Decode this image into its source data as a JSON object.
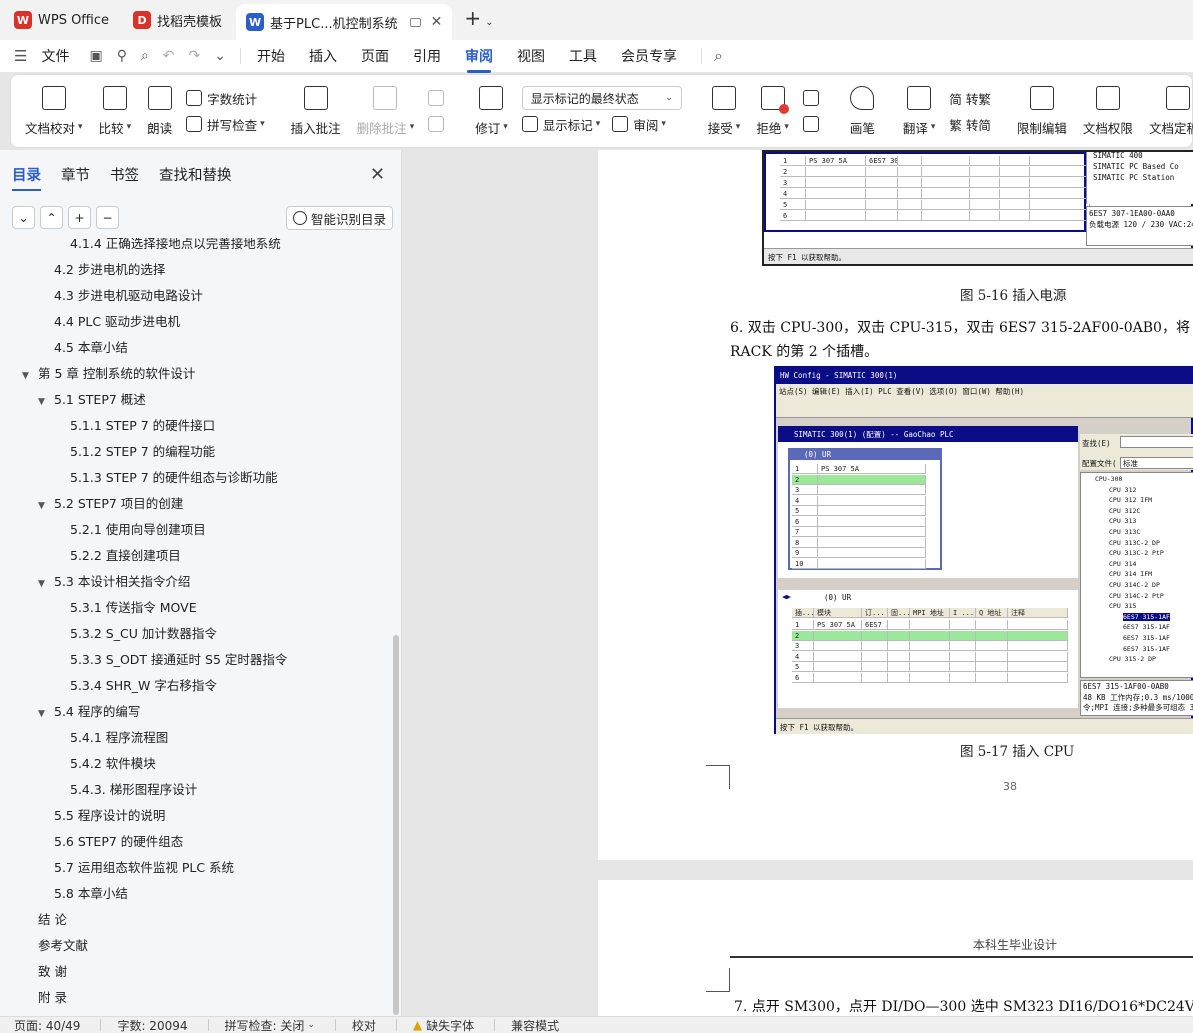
{
  "tabs": [
    {
      "label": "WPS Office",
      "color": "#d8322a",
      "icon": "W"
    },
    {
      "label": "找稻壳模板",
      "color": "#d8322a",
      "icon": "D"
    },
    {
      "label": "基于PLC...机控制系统",
      "color": "#2b5ec8",
      "icon": "W"
    }
  ],
  "menubar": {
    "file": "文件",
    "items": [
      "开始",
      "插入",
      "页面",
      "引用",
      "审阅",
      "视图",
      "工具",
      "会员专享"
    ],
    "active": "审阅"
  },
  "ribbon": {
    "doc_proof": "文档校对",
    "compare": "比较",
    "read": "朗读",
    "word_count": "字数统计",
    "spell_check": "拼写检查",
    "insert_comment": "插入批注",
    "delete_comment": "删除批注",
    "revise": "修订",
    "markup_state": "显示标记的最终状态",
    "show_markup": "显示标记",
    "review": "审阅",
    "accept": "接受",
    "reject": "拒绝",
    "pen": "画笔",
    "translate": "翻译",
    "trad": "简 转繁",
    "simp": "繁 转简",
    "restrict": "限制编辑",
    "permission": "文档权限",
    "finalize": "文档定稿"
  },
  "nav": {
    "tabs": [
      "目录",
      "章节",
      "书签",
      "查找和替换"
    ],
    "active_tab": "目录",
    "smart_toc": "智能识别目录",
    "toc": [
      {
        "label": "4.1.4 正确选择接地点以完善接地系统",
        "level": 3,
        "expand": ""
      },
      {
        "label": "4.2  步进电机的选择",
        "level": 2,
        "expand": ""
      },
      {
        "label": "4.3  步进电机驱动电路设计",
        "level": 2,
        "expand": ""
      },
      {
        "label": "4.4 PLC 驱动步进电机",
        "level": 2,
        "expand": ""
      },
      {
        "label": "4.5  本章小结",
        "level": 2,
        "expand": ""
      },
      {
        "label": "第 5 章  控制系统的软件设计",
        "level": 1,
        "expand": "▼"
      },
      {
        "label": "5.1 STEP7 概述",
        "level": 2,
        "expand": "▼"
      },
      {
        "label": "5.1.1 STEP  7 的硬件接口",
        "level": 3,
        "expand": ""
      },
      {
        "label": "5.1.2 STEP  7 的编程功能",
        "level": 3,
        "expand": ""
      },
      {
        "label": "5.1.3 STEP  7 的硬件组态与诊断功能",
        "level": 3,
        "expand": ""
      },
      {
        "label": "5.2 STEP7 项目的创建",
        "level": 2,
        "expand": "▼"
      },
      {
        "label": "5.2.1  使用向导创建项目",
        "level": 3,
        "expand": ""
      },
      {
        "label": "5.2.2  直接创建项目",
        "level": 3,
        "expand": ""
      },
      {
        "label": "5.3  本设计相关指令介绍",
        "level": 2,
        "expand": "▼"
      },
      {
        "label": "5.3.1  传送指令 MOVE",
        "level": 3,
        "expand": ""
      },
      {
        "label": "5.3.2 S_CU  加计数器指令",
        "level": 3,
        "expand": ""
      },
      {
        "label": "5.3.3 S_ODT 接通延时  S5  定时器指令",
        "level": 3,
        "expand": ""
      },
      {
        "label": "5.3.4 SHR_W  字右移指令",
        "level": 3,
        "expand": ""
      },
      {
        "label": "5.4  程序的编写",
        "level": 2,
        "expand": "▼"
      },
      {
        "label": "5.4.1  程序流程图",
        "level": 3,
        "expand": ""
      },
      {
        "label": "5.4.2  软件模块",
        "level": 3,
        "expand": ""
      },
      {
        "label": "5.4.3.  梯形图程序设计",
        "level": 3,
        "expand": ""
      },
      {
        "label": "5.5  程序设计的说明",
        "level": 2,
        "expand": ""
      },
      {
        "label": "5.6 STEP7 的硬件组态",
        "level": 2,
        "expand": ""
      },
      {
        "label": "5.7  运用组态软件监视 PLC 系统",
        "level": 2,
        "expand": ""
      },
      {
        "label": "5.8  本章小结",
        "level": 2,
        "expand": ""
      },
      {
        "label": "结  论",
        "level": 1,
        "expand": ""
      },
      {
        "label": "参考文献",
        "level": 1,
        "expand": ""
      },
      {
        "label": "致  谢",
        "level": 1,
        "expand": ""
      },
      {
        "label": "附  录",
        "level": 1,
        "expand": ""
      }
    ]
  },
  "doc": {
    "fig16": {
      "rows": [
        "1",
        "2",
        "3",
        "4",
        "5",
        "6"
      ],
      "row1_module": "PS 307 5A",
      "row1_order": "6ES7 307",
      "tree": [
        "SIMATIC 400",
        "SIMATIC PC Based Co",
        "SIMATIC PC Station"
      ],
      "info1": "6ES7 307-1EA00-0AA0",
      "info2": "负载电源 120 / 230 VAC:24",
      "status": "按下 F1 以获取帮助。"
    },
    "caption16": "图 5-16  插入电源",
    "para6_line1": "6.  双击 CPU-300，双击 CPU-315，双击 6ES7 315-2AF00-0AB0，将",
    "para6_line2": "RACK 的第 2 个插槽。",
    "fig17": {
      "title": "HW Config - SIMATIC 300(1)",
      "menu": "站点(S)  编辑(E)  插入(I)  PLC  查看(V)  选项(O)  窗口(W)  帮助(H)",
      "subtitle": "SIMATIC 300(1) (配置) -- GaoChao PLC",
      "rack_title": "(0) UR",
      "rack_rows": [
        "1",
        "2",
        "3",
        "4",
        "5",
        "6",
        "7",
        "8",
        "9",
        "10"
      ],
      "row1_module": "PS 307 5A",
      "search": "查找(E)",
      "profile": "配置文件(",
      "profile_value": "标准",
      "tree": [
        "CPU-300",
        "CPU 312",
        "CPU 312 IFM",
        "CPU 312C",
        "CPU 313",
        "CPU 313C",
        "CPU 313C-2 DP",
        "CPU 313C-2 PtP",
        "CPU 314",
        "CPU 314 IFM",
        "CPU 314C-2 DP",
        "CPU 314C-2 PtP",
        "CPU 315",
        "6ES7 315-1AF",
        "6ES7 315-1AF",
        "6ES7 315-1AF",
        "6ES7 315-1AF",
        "CPU 315-2 DP"
      ],
      "lower_title": "(0)    UR",
      "cols": [
        "插...",
        "模块",
        "订...",
        "固...",
        "MPI 地址",
        "I ...",
        "Q 地址",
        "注释"
      ],
      "lower_rows": [
        "1",
        "2",
        "3",
        "4",
        "5",
        "6"
      ],
      "info1": "6ES7 315-1AF00-0AB0",
      "info2": "48 KB 工作内存;0.3 ms/1000 条",
      "info3": "令;MPI 连接;多种最多可组态 3",
      "status": "按下 F1 以获取帮助。"
    },
    "caption17": "图 5-17  插入 CPU",
    "page_num": "38",
    "header2": "本科生毕业设计",
    "para7": "7.  点开 SM300，点开 DI/DO—300 选中 SM323 DI16/DO16*DC24V"
  },
  "status": {
    "page": "页面: 40/49",
    "words": "字数: 20094",
    "spell": "拼写检查: 关闭",
    "proof": "校对",
    "missing_font": "缺失字体",
    "compat": "兼容模式"
  }
}
